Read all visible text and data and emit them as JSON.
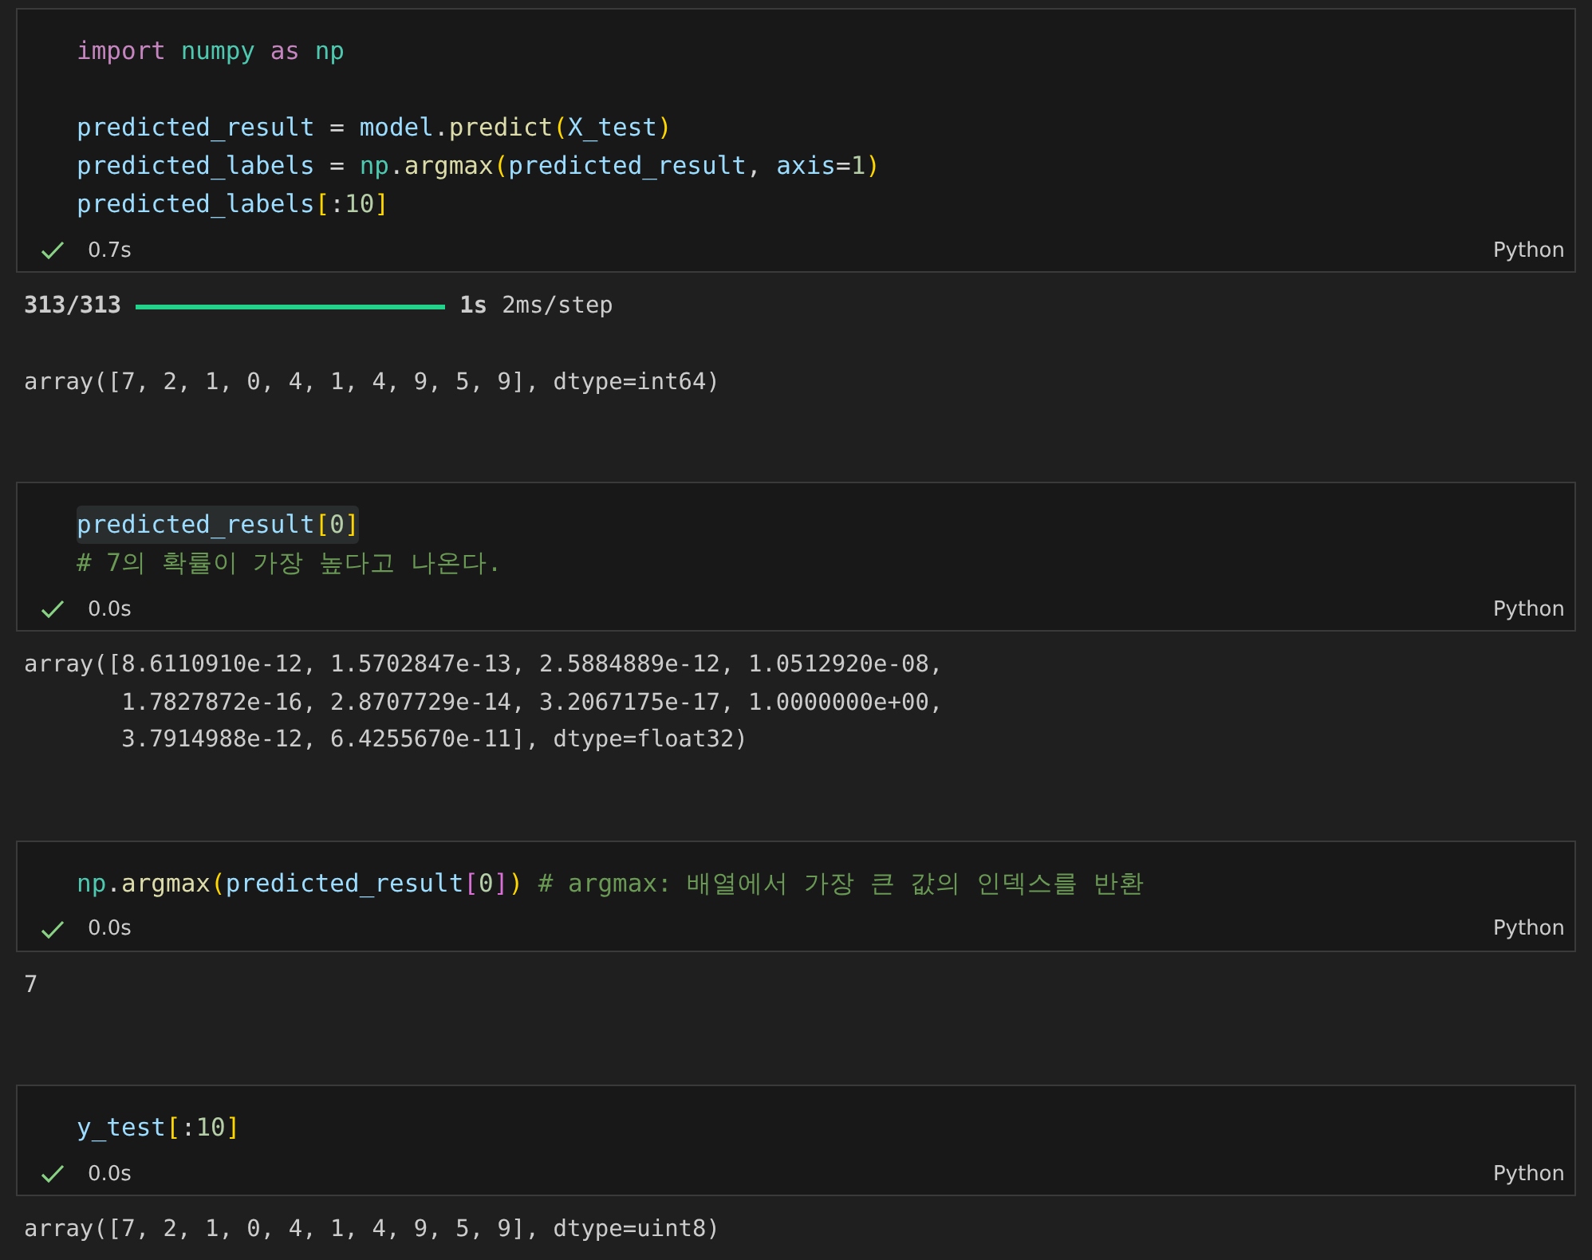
{
  "cells": [
    {
      "lines": [
        {
          "kind": "code",
          "tokens": [
            {
              "kind": "keyword",
              "text": "import "
            },
            {
              "kind": "module",
              "text": "numpy "
            },
            {
              "kind": "keyword",
              "text": "as "
            },
            {
              "kind": "module",
              "text": "np"
            }
          ]
        },
        {
          "kind": "blank"
        },
        {
          "kind": "code",
          "tokens": [
            {
              "kind": "variable",
              "text": "predicted_result"
            },
            {
              "kind": "plain",
              "text": " = "
            },
            {
              "kind": "variable",
              "text": "model"
            },
            {
              "kind": "plain",
              "text": "."
            },
            {
              "kind": "function",
              "text": "predict"
            },
            {
              "kind": "bracket",
              "text": "("
            },
            {
              "kind": "variable",
              "text": "X_test"
            },
            {
              "kind": "bracket",
              "text": ")"
            }
          ]
        },
        {
          "kind": "code",
          "tokens": [
            {
              "kind": "variable",
              "text": "predicted_labels"
            },
            {
              "kind": "plain",
              "text": " = "
            },
            {
              "kind": "module",
              "text": "np"
            },
            {
              "kind": "plain",
              "text": "."
            },
            {
              "kind": "function",
              "text": "argmax"
            },
            {
              "kind": "bracket",
              "text": "("
            },
            {
              "kind": "variable",
              "text": "predicted_result"
            },
            {
              "kind": "plain",
              "text": ", "
            },
            {
              "kind": "variable",
              "text": "axis"
            },
            {
              "kind": "plain",
              "text": "="
            },
            {
              "kind": "number",
              "text": "1"
            },
            {
              "kind": "bracket",
              "text": ")"
            }
          ]
        },
        {
          "kind": "code",
          "tokens": [
            {
              "kind": "variable",
              "text": "predicted_labels"
            },
            {
              "kind": "bracket",
              "text": "["
            },
            {
              "kind": "plain",
              "text": ":"
            },
            {
              "kind": "number",
              "text": "10"
            },
            {
              "kind": "bracket",
              "text": "]"
            }
          ]
        }
      ],
      "time": "0.7s",
      "language": "Python",
      "outputs": [
        {
          "kind": "progress",
          "count": "313/313",
          "level": 1,
          "duration": "1s",
          "rate": "2ms/step"
        },
        {
          "kind": "text",
          "lines": [
            "array([7, 2, 1, 0, 4, 1, 4, 9, 5, 9], dtype=int64)"
          ]
        }
      ]
    },
    {
      "lines": [
        {
          "kind": "code",
          "highlighted": true,
          "tokens": [
            {
              "kind": "variable",
              "text": "predicted_result"
            },
            {
              "kind": "bracket",
              "text": "["
            },
            {
              "kind": "number",
              "text": "0"
            },
            {
              "kind": "bracket",
              "text": "]"
            }
          ]
        },
        {
          "kind": "code",
          "tokens": [
            {
              "kind": "comment",
              "text": "# 7의 확률이 가장 높다고 나온다."
            }
          ]
        }
      ],
      "time": "0.0s",
      "language": "Python",
      "outputs": [
        {
          "kind": "text",
          "lines": [
            "array([8.6110910e-12, 1.5702847e-13, 2.5884889e-12, 1.0512920e-08,",
            "       1.7827872e-16, 2.8707729e-14, 3.2067175e-17, 1.0000000e+00,",
            "       3.7914988e-12, 6.4255670e-11], dtype=float32)"
          ]
        }
      ]
    },
    {
      "lines": [
        {
          "kind": "code",
          "tokens": [
            {
              "kind": "module",
              "text": "np"
            },
            {
              "kind": "plain",
              "text": "."
            },
            {
              "kind": "function",
              "text": "argmax"
            },
            {
              "kind": "bracket",
              "text": "("
            },
            {
              "kind": "variable",
              "text": "predicted_result"
            },
            {
              "kind": "bracket2",
              "text": "["
            },
            {
              "kind": "number",
              "text": "0"
            },
            {
              "kind": "bracket2",
              "text": "]"
            },
            {
              "kind": "bracket",
              "text": ") "
            },
            {
              "kind": "comment",
              "text": "# argmax: 배열에서 가장 큰 값의 인덱스를 반환"
            }
          ]
        }
      ],
      "time": "0.0s",
      "language": "Python",
      "outputs": [
        {
          "kind": "text",
          "lines": [
            "7"
          ]
        }
      ]
    },
    {
      "lines": [
        {
          "kind": "code",
          "tokens": [
            {
              "kind": "variable",
              "text": "y_test"
            },
            {
              "kind": "bracket",
              "text": "["
            },
            {
              "kind": "plain",
              "text": ":"
            },
            {
              "kind": "number",
              "text": "10"
            },
            {
              "kind": "bracket",
              "text": "]"
            }
          ]
        }
      ],
      "time": "0.0s",
      "language": "Python",
      "outputs": [
        {
          "kind": "text",
          "lines": [
            "array([7, 2, 1, 0, 4, 1, 4, 9, 5, 9], dtype=uint8)"
          ]
        }
      ]
    }
  ]
}
